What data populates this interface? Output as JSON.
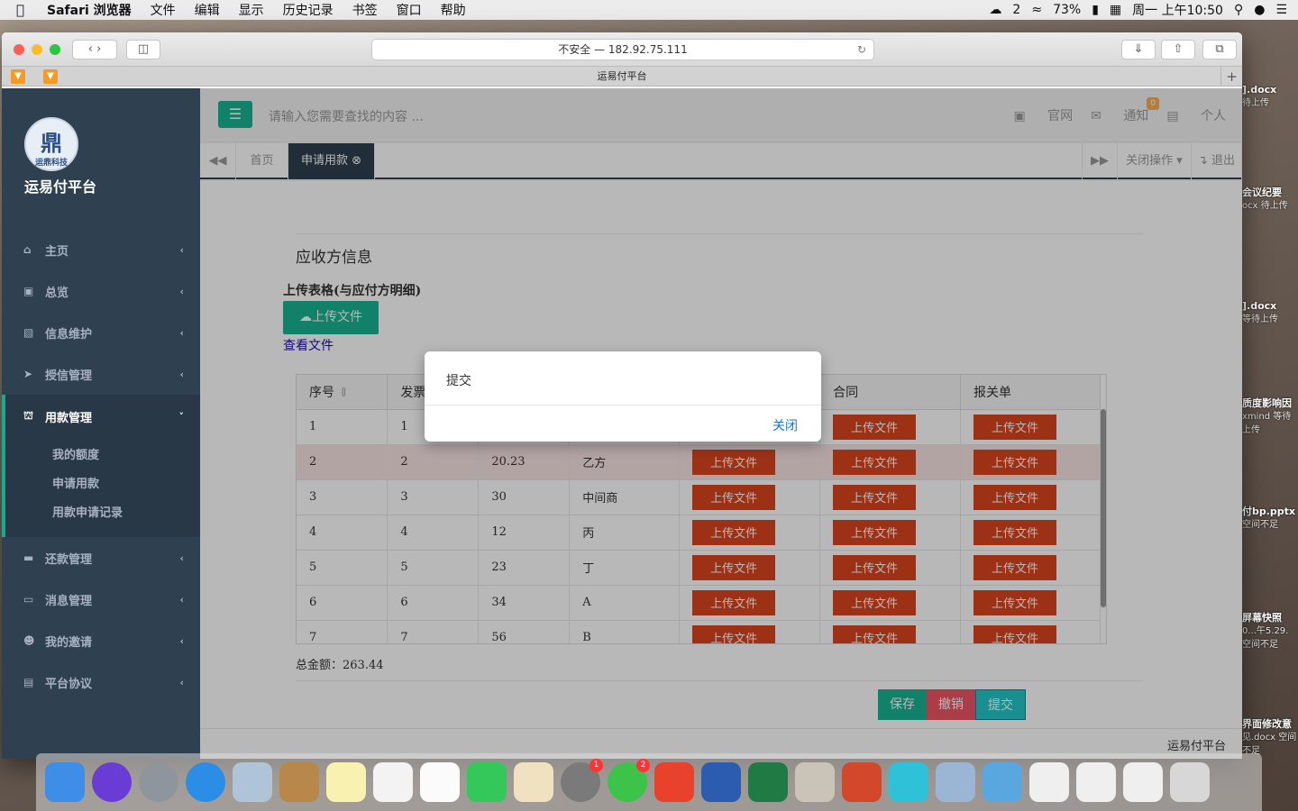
{
  "menubar": {
    "apple": "",
    "items": [
      "Safari 浏览器",
      "文件",
      "编辑",
      "显示",
      "历史记录",
      "书签",
      "窗口",
      "帮助"
    ],
    "status_wechat": "2",
    "status_battery": "73%",
    "status_time": "周一 上午10:50"
  },
  "desktop_files": [
    {
      "name": "].docx",
      "sub": "待上传"
    },
    {
      "name": "会议纪要",
      "sub": "ocx 待上传"
    },
    {
      "name": "].docx",
      "sub": "等待上传"
    },
    {
      "name": "质度影响因",
      "sub": "xmind 等待上传"
    },
    {
      "name": "付bp.pptx",
      "sub": "空间不足"
    },
    {
      "name": "屏幕快照",
      "sub": "0...午5.29. 空间不足"
    },
    {
      "name": "界面修改意",
      "sub": "见.docx 空间不足"
    }
  ],
  "browser": {
    "url": "不安全 — 182.92.75.111",
    "tab_title": "运易付平台"
  },
  "sidebar": {
    "title": "运易付平台",
    "logo_text": "运鼎科技",
    "items": [
      {
        "label": "主页",
        "icon": "home-icon"
      },
      {
        "label": "总览",
        "icon": "desktop-icon"
      },
      {
        "label": "信息维护",
        "icon": "bar-chart-icon"
      },
      {
        "label": "授信管理",
        "icon": "paper-plane-icon"
      },
      {
        "label": "用款管理",
        "icon": "bank-icon"
      },
      {
        "label": "还款管理",
        "icon": "credit-card-icon"
      },
      {
        "label": "消息管理",
        "icon": "laptop-icon"
      },
      {
        "label": "我的邀请",
        "icon": "users-icon"
      },
      {
        "label": "平台协议",
        "icon": "file-icon"
      }
    ],
    "sub_items": [
      "我的额度",
      "申请用款",
      "用款申请记录"
    ]
  },
  "topnav": {
    "search_placeholder": "请输入您需要查找的内容 ...",
    "official_site": "官网",
    "notify": "通知",
    "notify_count": "0",
    "profile": "个人"
  },
  "tabs": {
    "home": "首页",
    "current": "申请用款",
    "close_ops": "关闭操作",
    "logout": "退出"
  },
  "content": {
    "section_title": "应收方信息",
    "upload_label": "上传表格(与应付方明细)",
    "upload_button": "上传文件",
    "view_files": "查看文件",
    "columns": [
      "序号",
      "发票",
      "",
      "",
      "",
      "合同",
      "报关单"
    ],
    "rows": [
      {
        "seq": "1",
        "invoice": "1",
        "amount": "",
        "party": ""
      },
      {
        "seq": "2",
        "invoice": "2",
        "amount": "20.23",
        "party": "乙方"
      },
      {
        "seq": "3",
        "invoice": "3",
        "amount": "30",
        "party": "中间商"
      },
      {
        "seq": "4",
        "invoice": "4",
        "amount": "12",
        "party": "丙"
      },
      {
        "seq": "5",
        "invoice": "5",
        "amount": "23",
        "party": "丁"
      },
      {
        "seq": "6",
        "invoice": "6",
        "amount": "34",
        "party": "A"
      },
      {
        "seq": "7",
        "invoice": "7",
        "amount": "56",
        "party": "B"
      }
    ],
    "row_upload_label": "上传文件",
    "total": "总金额：263.44",
    "save": "保存",
    "cancel": "撤销",
    "submit": "提交"
  },
  "footer": "运易付平台",
  "modal": {
    "body": "提交",
    "close": "关闭"
  },
  "dock": {
    "wechat_badge": "2",
    "settings_badge": "1"
  }
}
